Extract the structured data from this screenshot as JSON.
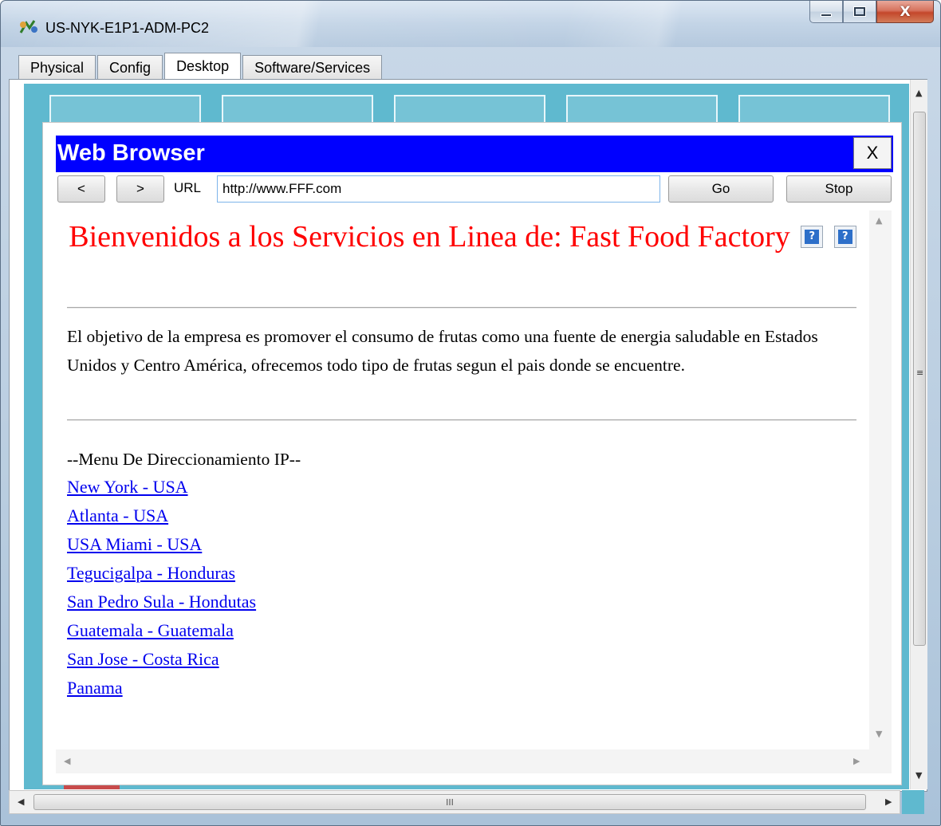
{
  "window": {
    "title": "US-NYK-E1P1-ADM-PC2",
    "close_glyph": "X"
  },
  "tabs": [
    {
      "label": "Physical",
      "active": false
    },
    {
      "label": "Config",
      "active": false
    },
    {
      "label": "Desktop",
      "active": true
    },
    {
      "label": "Software/Services",
      "active": false
    }
  ],
  "browser": {
    "title": "Web Browser",
    "close_label": "X",
    "back_label": "<",
    "forward_label": ">",
    "url_label": "URL",
    "url_value": "http://www.FFF.com",
    "go_label": "Go",
    "stop_label": "Stop"
  },
  "page": {
    "title": "Bienvenidos a los Servicios en Linea de: Fast Food Factory",
    "broken_image_glyph": "?",
    "intro": "El objetivo de la empresa es promover el consumo de frutas como una fuente de energia saludable en Estados Unidos y Centro América, ofrecemos todo tipo de frutas segun el pais donde se encuentre.",
    "menu_title": "--Menu De Direccionamiento IP--",
    "links": [
      "New York - USA",
      "Atlanta - USA",
      "USA Miami - USA",
      "Tegucigalpa - Honduras",
      "San Pedro Sula - Hondutas",
      "Guatemala - Guatemala",
      "San Jose - Costa Rica",
      "Panama"
    ]
  },
  "scrollbar": {
    "grip_glyph": "III",
    "mid_glyph": "≡"
  },
  "colors": {
    "browser_header": "#0000ff",
    "page_title": "#ff0000",
    "link": "#0000ee",
    "desktop_bg": "#5fb9cf"
  }
}
